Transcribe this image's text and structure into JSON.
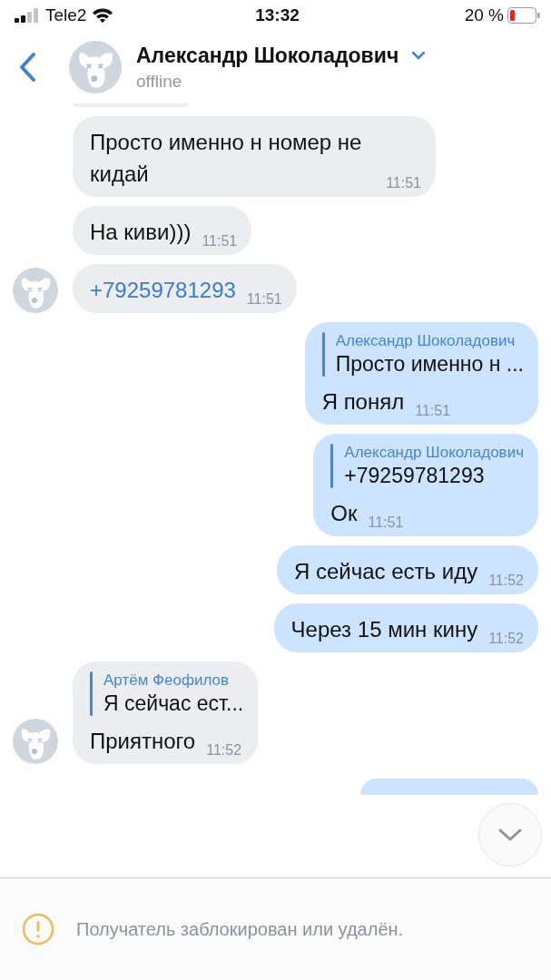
{
  "status_bar": {
    "carrier": "Tele2",
    "time": "13:32",
    "battery": "20 %"
  },
  "header": {
    "name": "Александр Шоколадович",
    "status": "offline"
  },
  "messages": [
    {
      "kind": "in",
      "avatar": false,
      "link": false,
      "text": "Просто именно н номер не кидай",
      "time": "11:51"
    },
    {
      "kind": "in",
      "avatar": false,
      "link": false,
      "text": "На киви)))",
      "time": "11:51"
    },
    {
      "kind": "in",
      "avatar": true,
      "link": true,
      "text": "+79259781293",
      "time": "11:51"
    },
    {
      "kind": "out",
      "link": false,
      "reply": {
        "author": "Александр Шоколадович",
        "text": "Просто именно н ..."
      },
      "text": "Я понял",
      "time": "11:51"
    },
    {
      "kind": "out",
      "link": false,
      "reply": {
        "author": "Александр Шоколадович",
        "text": "+79259781293"
      },
      "text": "Ок",
      "time": "11:51"
    },
    {
      "kind": "out",
      "link": false,
      "text": "Я сейчас есть иду",
      "time": "11:52"
    },
    {
      "kind": "out",
      "link": false,
      "text": "Через 15 мин кину",
      "time": "11:52"
    },
    {
      "kind": "in",
      "avatar": true,
      "link": false,
      "reply": {
        "author": "Артём Феофилов",
        "text": "Я сейчас ест..."
      },
      "text": "Приятного",
      "time": "11:52"
    }
  ],
  "notice": "Получатель заблокирован или удалён."
}
